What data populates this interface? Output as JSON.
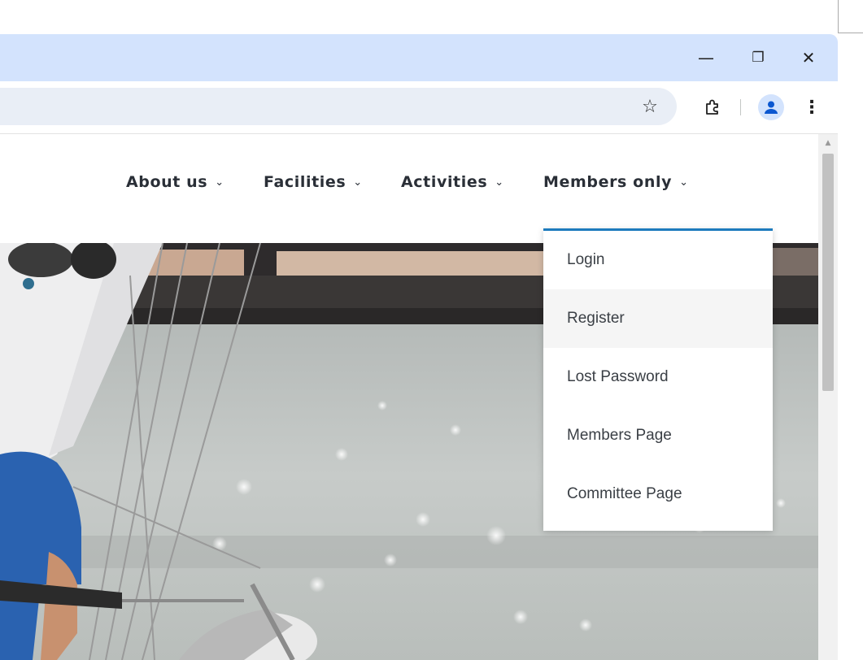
{
  "browser": {
    "window_controls": {
      "minimize_glyph": "—",
      "restore_glyph": "❐",
      "close_glyph": "✕"
    },
    "toolbar": {
      "bookmark_glyph": "☆",
      "menu_glyph": "⋮"
    }
  },
  "nav": {
    "items": [
      {
        "label": "About us",
        "chevron": "⌄"
      },
      {
        "label": "Facilities",
        "chevron": "⌄"
      },
      {
        "label": "Activities",
        "chevron": "⌄"
      },
      {
        "label": "Members only",
        "chevron": "⌄"
      }
    ]
  },
  "dropdown": {
    "accent": "#1d7bbd",
    "items": [
      {
        "label": "Login"
      },
      {
        "label": "Register",
        "hovered": true
      },
      {
        "label": "Lost Password"
      },
      {
        "label": "Members Page"
      },
      {
        "label": "Committee Page"
      }
    ]
  },
  "scrollbar": {
    "up_arrow": "▲"
  }
}
